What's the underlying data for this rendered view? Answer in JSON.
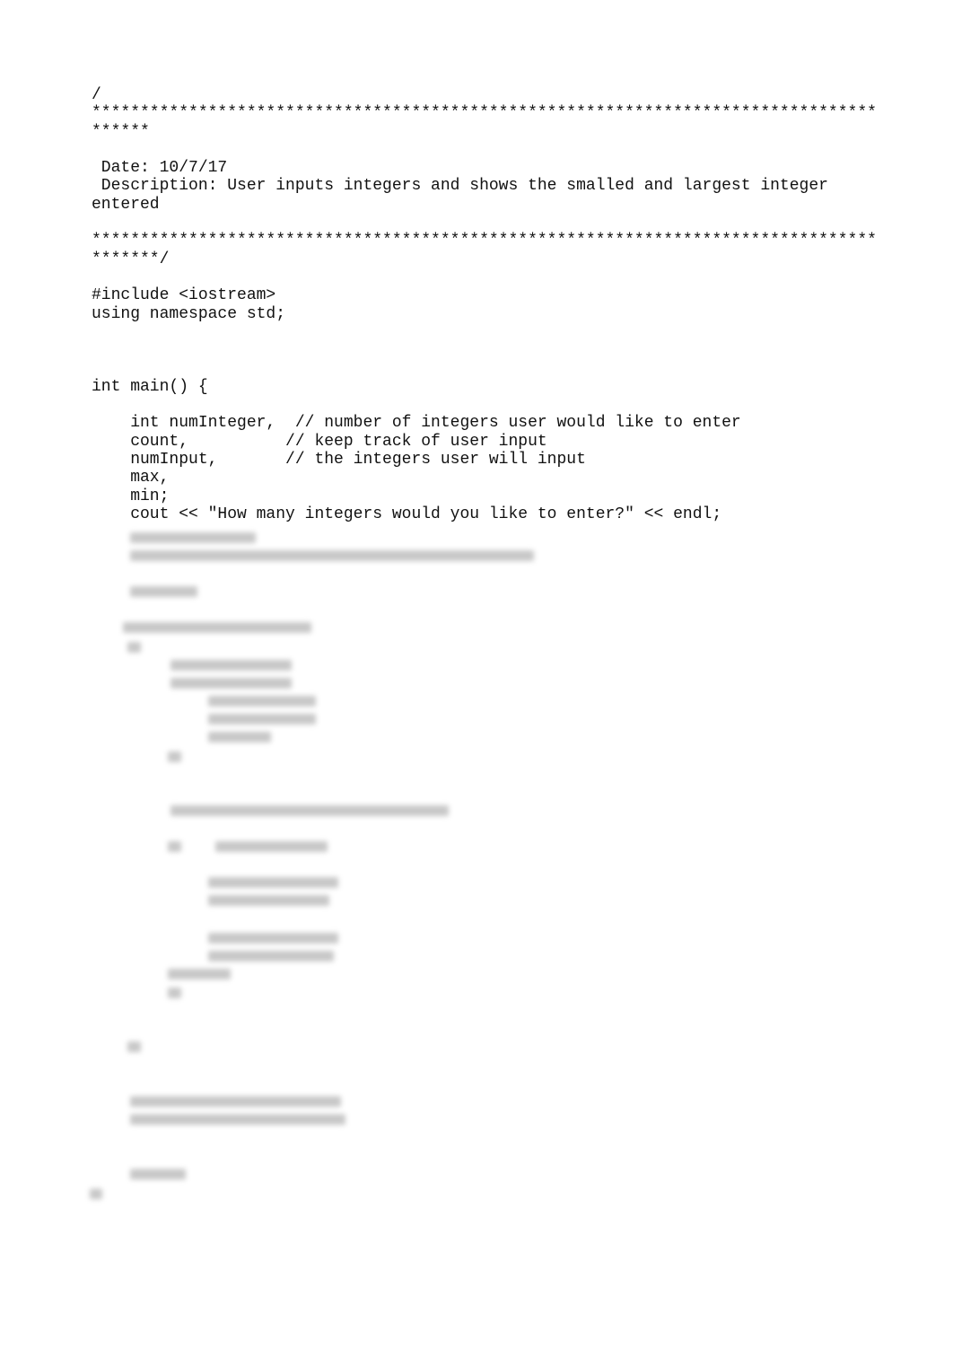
{
  "document": {
    "lines": [
      "/",
      "*********************************************************************************",
      "******",
      "",
      " Date: 10/7/17",
      " Description: User inputs integers and shows the smalled and largest integer",
      "entered",
      "",
      "*********************************************************************************",
      "*******/",
      "",
      "#include <iostream>",
      "using namespace std;",
      "",
      "",
      "",
      "int main() {",
      "",
      "    int numInteger,  // number of integers user would like to enter",
      "    count,          // keep track of user input",
      "    numInput,       // the integers user will input",
      "    max,",
      "    min;",
      "    cout << \"How many integers would you like to enter?\" << endl;"
    ]
  }
}
